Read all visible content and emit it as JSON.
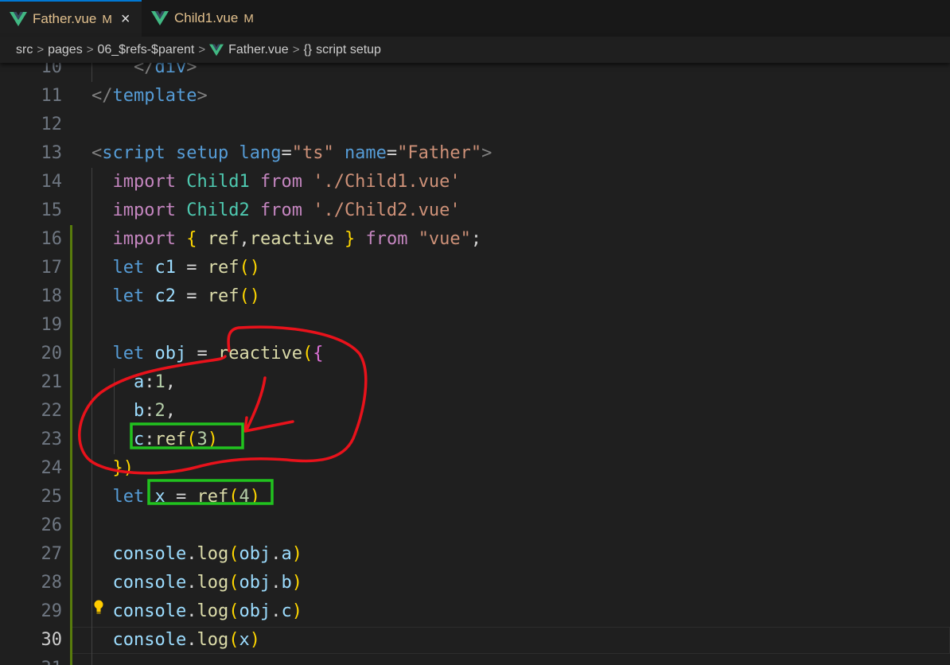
{
  "tabs": [
    {
      "name": "Father.vue",
      "status": "M",
      "close": "×",
      "active": true
    },
    {
      "name": "Child1.vue",
      "status": "M",
      "active": false
    }
  ],
  "breadcrumb": {
    "items": [
      "src",
      "pages",
      "06_$refs-$parent",
      "Father.vue",
      "script setup"
    ],
    "braces": "{}",
    "separator": ">"
  },
  "editor": {
    "active_line": 30,
    "lines": [
      {
        "n": "10",
        "text": "    </div>"
      },
      {
        "n": "11",
        "text": "</template>"
      },
      {
        "n": "12",
        "text": ""
      },
      {
        "n": "13",
        "text": "<script setup lang=\"ts\" name=\"Father\">"
      },
      {
        "n": "14",
        "text": "  import Child1 from './Child1.vue'"
      },
      {
        "n": "15",
        "text": "  import Child2 from './Child2.vue'"
      },
      {
        "n": "16",
        "text": "  import { ref,reactive } from \"vue\";"
      },
      {
        "n": "17",
        "text": "  let c1 = ref()"
      },
      {
        "n": "18",
        "text": "  let c2 = ref()"
      },
      {
        "n": "19",
        "text": ""
      },
      {
        "n": "20",
        "text": "  let obj = reactive({"
      },
      {
        "n": "21",
        "text": "    a:1,"
      },
      {
        "n": "22",
        "text": "    b:2,"
      },
      {
        "n": "23",
        "text": "    c:ref(3)"
      },
      {
        "n": "24",
        "text": "  })"
      },
      {
        "n": "25",
        "text": "  let x = ref(4)"
      },
      {
        "n": "26",
        "text": ""
      },
      {
        "n": "27",
        "text": "  console.log(obj.a)"
      },
      {
        "n": "28",
        "text": "  console.log(obj.b)"
      },
      {
        "n": "29",
        "text": "  console.log(obj.c)"
      },
      {
        "n": "30",
        "text": "  console.log(x)"
      },
      {
        "n": "31",
        "text": ""
      }
    ]
  },
  "colors": {
    "editor_bg": "#1f1f1f",
    "modified_tab_text": "#e2c08d",
    "annotation_red": "#e8121b",
    "annotation_green": "#21c21f",
    "git_modified_bar": "#587c0c",
    "vue_logo": "#41b883"
  },
  "icons": [
    "vue-logo-icon",
    "close-icon",
    "chevron-right-icon",
    "braces-icon",
    "lightbulb-icon"
  ]
}
